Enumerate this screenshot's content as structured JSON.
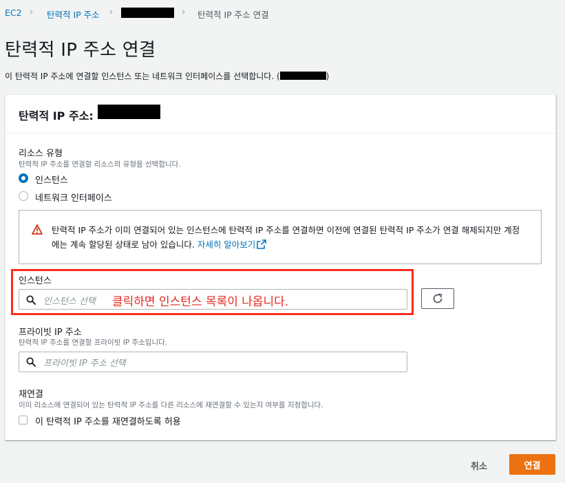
{
  "breadcrumb": {
    "items": [
      "EC2",
      "탄력적 IP 주소",
      "",
      "탄력적 IP 주소 연결"
    ]
  },
  "page": {
    "title": "탄력적 IP 주소 연결",
    "description": "이 탄력적 IP 주소에 연결할 인스턴스 또는 네트워크 인터페이스를 선택합니다. (",
    "description_close": ")"
  },
  "panel": {
    "title": "탄력적 IP 주소:"
  },
  "resource_type": {
    "label": "리소스 유형",
    "hint": "탄력적 IP 주소를 연결할 리소스의 유형을 선택합니다.",
    "options": [
      "인스턴스",
      "네트워크 인터페이스"
    ],
    "selected": "인스턴스"
  },
  "alert": {
    "text": "탄력적 IP 주소가 이미 연결되어 있는 인스턴스에 탄력적 IP 주소를 연결하면 이전에 연결된 탄력적 IP 주소가 연결 해제되지만 계정에는 계속 할당된 상태로 남아 있습니다.",
    "link": "자세히 알아보기"
  },
  "instance": {
    "label": "인스턴스",
    "placeholder": "인스턴스 선택",
    "annotation": "클릭하면 인스턴스 목록이 나옵니다."
  },
  "private_ip": {
    "label": "프라이빗 IP 주소",
    "hint": "탄력적 IP 주소를 연결할 프라이빗 IP 주소입니다.",
    "placeholder": "프라이빗 IP 주소 선택"
  },
  "reassociation": {
    "label": "재연결",
    "hint": "이미 리소스에 연결되어 있는 탄력적 IP 주소를 다른 리소스에 재연결할 수 있는지 여부를 지정합니다.",
    "checkbox_label": "이 탄력적 IP 주소를 재연결하도록 허용",
    "checked": false
  },
  "footer": {
    "cancel": "취소",
    "submit": "연결"
  },
  "colors": {
    "link": "#0073bb",
    "primary": "#ec7211",
    "annotation": "#e02b1f",
    "warning": "#d13212"
  },
  "icons": [
    "chevron-right-icon",
    "warning-icon",
    "external-link-icon",
    "search-icon",
    "refresh-icon"
  ]
}
